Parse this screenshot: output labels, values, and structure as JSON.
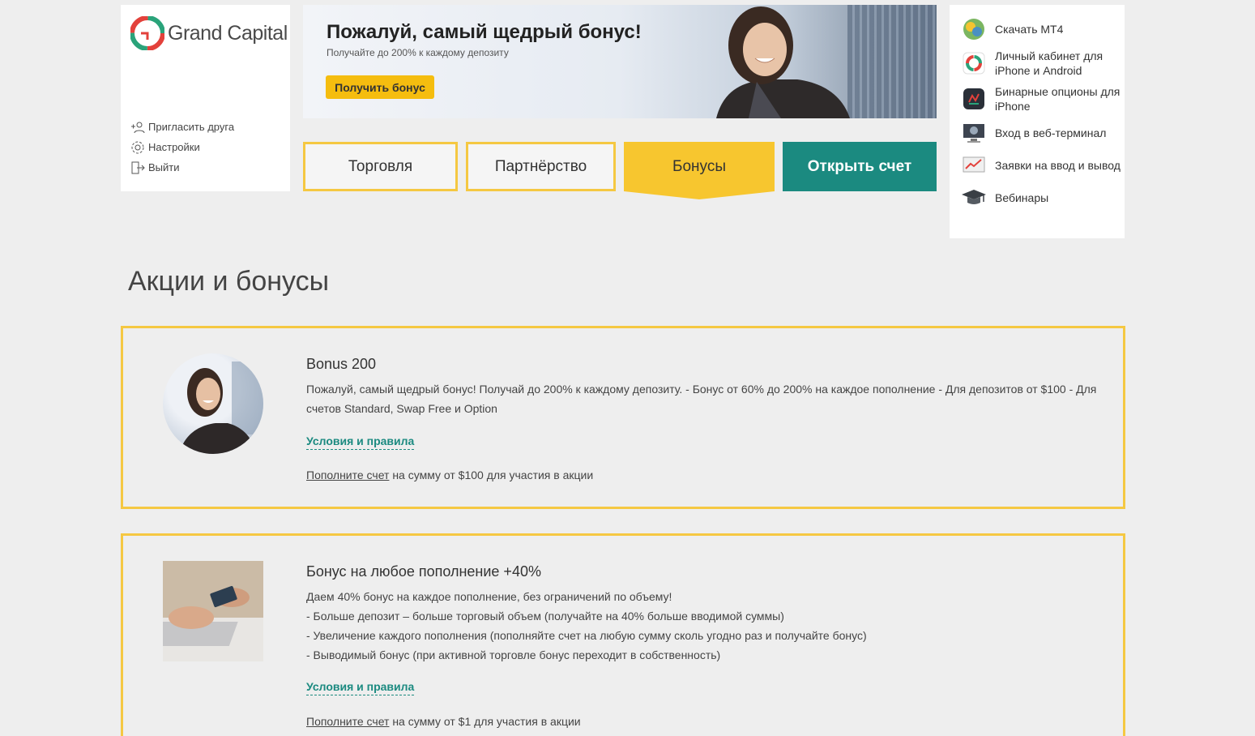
{
  "brand": {
    "name": "Grand Capital"
  },
  "user_menu": [
    {
      "label": "Пригласить друга",
      "icon": "add-user-icon"
    },
    {
      "label": "Настройки",
      "icon": "gear-icon"
    },
    {
      "label": "Выйти",
      "icon": "logout-icon"
    }
  ],
  "banner": {
    "title": "Пожалуй, самый щедрый бонус!",
    "subtitle": "Получайте до 200% к каждому депозиту",
    "button": "Получить бонус"
  },
  "nav": {
    "trade": "Торговля",
    "partner": "Партнёрство",
    "bonus": "Бонусы",
    "open_account": "Открыть счет"
  },
  "sidebar": [
    {
      "label": "Скачать MT4",
      "icon": "mt4-icon"
    },
    {
      "label": "Личный кабинет для iPhone и Android",
      "icon": "mobile-app-icon"
    },
    {
      "label": "Бинарные опционы для iPhone",
      "icon": "binary-options-icon"
    },
    {
      "label": "Вход в веб-терминал",
      "icon": "web-terminal-icon"
    },
    {
      "label": "Заявки на ввод и вывод",
      "icon": "requests-icon"
    },
    {
      "label": "Вебинары",
      "icon": "graduation-cap-icon"
    }
  ],
  "page_title": "Акции и бонусы",
  "promos": [
    {
      "title": "Bonus 200",
      "text": [
        "Пожалуй, самый щедрый бонус! Получай до 200% к каждому депозиту. - Бонус от 60% до 200% на каждое пополнение - Для депозитов от $100 - Для счетов Standard, Swap Free и Option"
      ],
      "rules_link": "Условия и правила",
      "deposit_link": "Пополните счет",
      "deposit_rest": " на сумму от $100 для участия в акции"
    },
    {
      "title": "Бонус на любое пополнение +40%",
      "text": [
        "Даем 40% бонус на каждое пополнение, без ограничений по объему!",
        "- Больше депозит – больше торговый объем (получайте на 40% больше вводимой суммы)",
        "- Увеличение каждого пополнения (пополняйте счет на любую сумму сколь угодно раз и получайте бонус)",
        "- Выводимый бонус (при активной торговле бонус переходит в собственность)"
      ],
      "rules_link": "Условия и правила",
      "deposit_link": "Пополните счет",
      "deposit_rest": " на сумму от $1 для участия в акции"
    }
  ],
  "colors": {
    "accent_yellow": "#f5c842",
    "teal": "#1b8a80",
    "logo_red": "#e3413b",
    "logo_green": "#2aa37a"
  }
}
